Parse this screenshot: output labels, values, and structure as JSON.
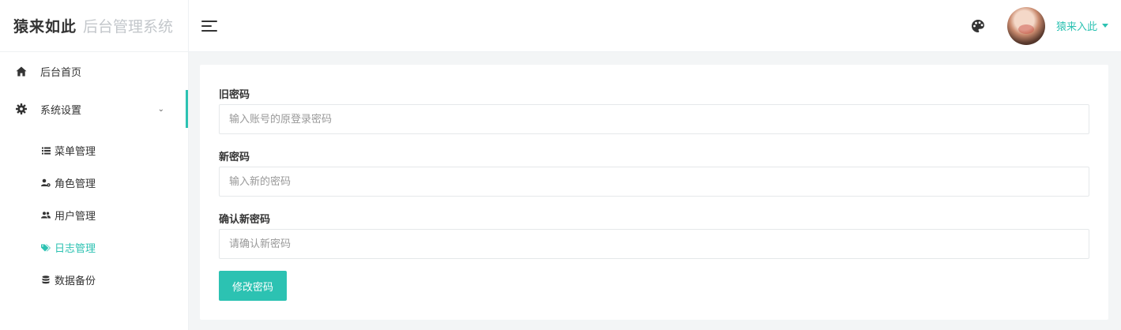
{
  "brand": {
    "logo": "猿来如此",
    "subtitle": "后台管理系统"
  },
  "header": {
    "user_name": "猿来入此"
  },
  "sidebar": {
    "items": [
      {
        "label": "后台首页",
        "icon": "home-icon"
      },
      {
        "label": "系统设置",
        "icon": "gear-icon"
      }
    ],
    "sub_items": [
      {
        "label": "菜单管理",
        "icon": "list-icon"
      },
      {
        "label": "角色管理",
        "icon": "user-gear-icon"
      },
      {
        "label": "用户管理",
        "icon": "users-icon"
      },
      {
        "label": "日志管理",
        "icon": "tags-icon"
      },
      {
        "label": "数据备份",
        "icon": "database-icon"
      }
    ]
  },
  "form": {
    "old_password": {
      "label": "旧密码",
      "placeholder": "输入账号的原登录密码"
    },
    "new_password": {
      "label": "新密码",
      "placeholder": "输入新的密码"
    },
    "confirm_password": {
      "label": "确认新密码",
      "placeholder": "请确认新密码"
    },
    "submit_label": "修改密码"
  },
  "colors": {
    "accent": "#2cc2b2",
    "background": "#f3f5f6",
    "text": "#333333"
  }
}
